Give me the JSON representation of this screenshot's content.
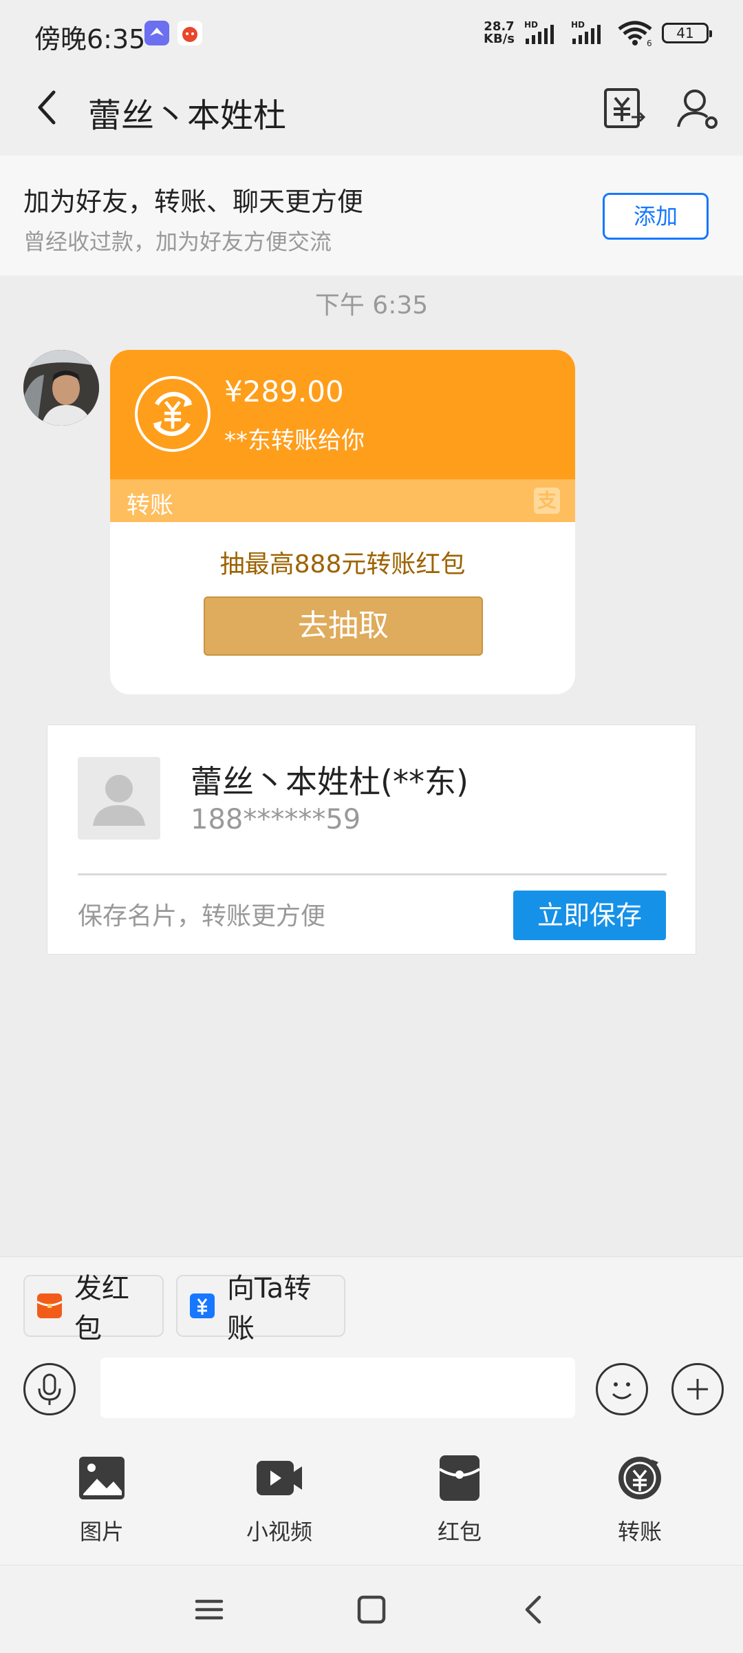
{
  "status_bar": {
    "time": "傍晚6:35",
    "net_speed_value": "28.7",
    "net_speed_unit": "KB/s",
    "hd_1": "HD",
    "hd_2": "HD",
    "wifi_badge": "6",
    "battery": "41"
  },
  "nav": {
    "title": "蕾丝丶本姓杜"
  },
  "add_friend_banner": {
    "title": "加为好友，转账、聊天更方便",
    "subtitle": "曾经收过款，加为好友方便交流",
    "button_label": "添加"
  },
  "chat": {
    "timestamp": "下午 6:35",
    "transfer_card": {
      "amount": "¥289.00",
      "from_text": "**东转账给你",
      "label": "转账",
      "alipay_glyph": "支",
      "promo_text": "抽最高888元转账红包",
      "button_label": "去抽取"
    },
    "contact_card": {
      "name": "蕾丝丶本姓杜(**东)",
      "phone": "188******59",
      "hint": "保存名片，转账更方便",
      "button_label": "立即保存"
    }
  },
  "quick_actions": [
    {
      "label": "发红包",
      "icon": "red-envelope-icon",
      "color": "#f25c1a"
    },
    {
      "label": "向Ta转账",
      "icon": "transfer-card-icon",
      "color": "#1677ff"
    }
  ],
  "input": {
    "placeholder": ""
  },
  "tools": [
    {
      "label": "图片",
      "icon": "image-icon"
    },
    {
      "label": "小视频",
      "icon": "video-icon"
    },
    {
      "label": "红包",
      "icon": "red-envelope-icon"
    },
    {
      "label": "转账",
      "icon": "transfer-icon"
    }
  ],
  "colors": {
    "transfer_orange": "#ff9e1b",
    "transfer_label_bar": "#ffbe5d",
    "primary_blue": "#1677ff",
    "save_button_blue": "#1691e8",
    "gold_button": "#dfab5c"
  }
}
